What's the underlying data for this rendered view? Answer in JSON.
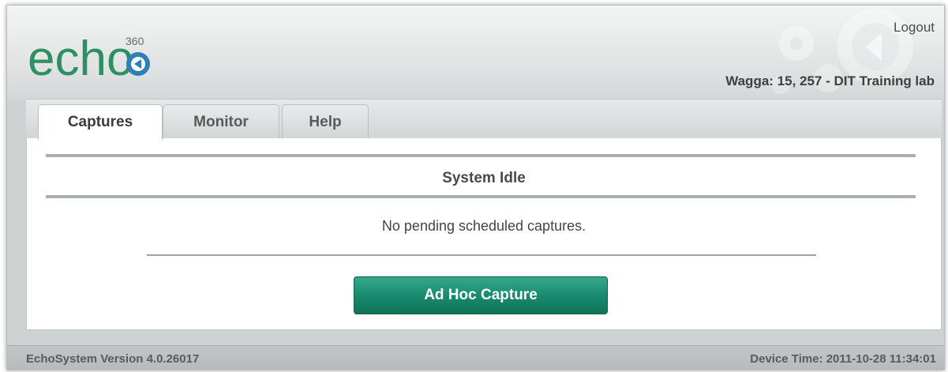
{
  "header": {
    "logo_text": "echo",
    "logo_superscript": "360",
    "logout_label": "Logout",
    "room_name": "Wagga: 15, 257 - DIT Training lab"
  },
  "tabs": [
    {
      "label": "Captures",
      "active": true
    },
    {
      "label": "Monitor",
      "active": false
    },
    {
      "label": "Help",
      "active": false
    }
  ],
  "main": {
    "status_text": "System Idle",
    "pending_text": "No pending scheduled captures.",
    "adhoc_button_label": "Ad Hoc Capture"
  },
  "footer": {
    "version": "EchoSystem Version 4.0.26017",
    "device_time": "Device Time: 2011-10-28 11:34:01"
  },
  "colors": {
    "brand_green": "#1a8b6f",
    "logo_green": "#2e8f63",
    "logo_blue": "#2f7fb8"
  }
}
